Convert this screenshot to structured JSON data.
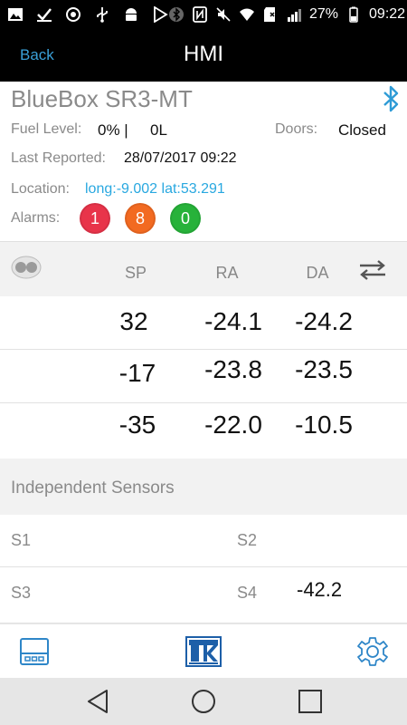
{
  "status_bar": {
    "icons": [
      "image-icon",
      "check-icon",
      "photo-icon",
      "usb-icon",
      "android-icon",
      "play-store-icon",
      "bluetooth-icon",
      "nfc-icon",
      "mute-icon",
      "wifi-icon",
      "sd-icon",
      "signal-icon",
      "battery-icon"
    ],
    "battery": "27%",
    "time": "09:22"
  },
  "action_bar": {
    "back_label": "Back",
    "title": "HMI"
  },
  "device": {
    "name": "BlueBox SR3-MT",
    "fuel_label": "Fuel Level:",
    "fuel_percent": "0% |",
    "fuel_liters": "0L",
    "doors_label": "Doors:",
    "doors_value": "Closed",
    "reported_label": "Last Reported:",
    "reported_value": "28/07/2017 09:22",
    "location_label": "Location:",
    "location_value": "long:-9.002 lat:53.291",
    "alarms_label": "Alarms:",
    "alarms": [
      {
        "count": "1",
        "color": "#e8344a"
      },
      {
        "count": "8",
        "color": "#f26a21"
      },
      {
        "count": "0",
        "color": "#27b23a"
      }
    ]
  },
  "zones": {
    "headers": [
      "SP",
      "RA",
      "DA"
    ],
    "rows": [
      [
        "32",
        "-24.1",
        "-24.2"
      ],
      [
        "-17",
        "-23.8",
        "-23.5"
      ],
      [
        "-35",
        "-22.0",
        "-10.5"
      ]
    ]
  },
  "sensors": {
    "title": "Independent Sensors",
    "items": [
      {
        "label": "S1",
        "value": ""
      },
      {
        "label": "S2",
        "value": ""
      },
      {
        "label": "S3",
        "value": ""
      },
      {
        "label": "S4",
        "value": "-42.2"
      }
    ]
  },
  "tabs": [
    "hmi-panel-icon",
    "thermo-king-logo",
    "settings-icon"
  ],
  "colors": {
    "accent": "#3aa0d8",
    "location": "#29a8e0",
    "header_bg": "#000000",
    "section_bg": "#f2f2f2"
  }
}
